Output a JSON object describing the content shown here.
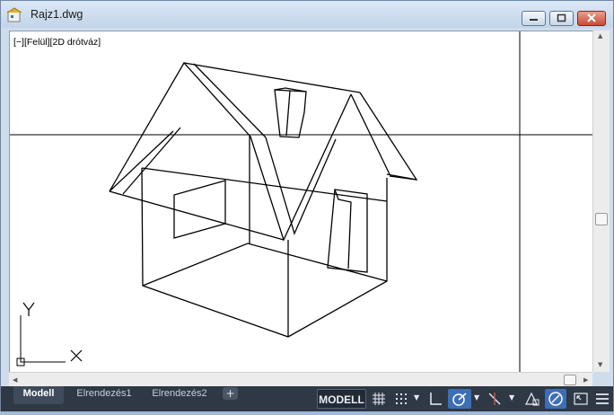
{
  "window": {
    "title": "Rajz1.dwg"
  },
  "viewport": {
    "label": "[−][Felül][2D drótváz]",
    "ucs_x": "X",
    "ucs_y": "Y"
  },
  "layout_tabs": [
    {
      "label": "Modell",
      "active": true
    },
    {
      "label": "Elrendezés1",
      "active": false
    },
    {
      "label": "Elrendezés2",
      "active": false
    }
  ],
  "add_tab_label": "+",
  "status": {
    "model_label": "MODELL",
    "icons": [
      "grid-icon",
      "snap-icon",
      "ortho-icon",
      "polar-icon",
      "osnap-icon",
      "annotation-icon",
      "isolate-icon",
      "fullscreen-icon",
      "menu-icon"
    ]
  },
  "colors": {
    "viewport_bg": "#ffffff",
    "statusbar_bg": "#2f3845",
    "accent_on": "#3d6fb6"
  }
}
